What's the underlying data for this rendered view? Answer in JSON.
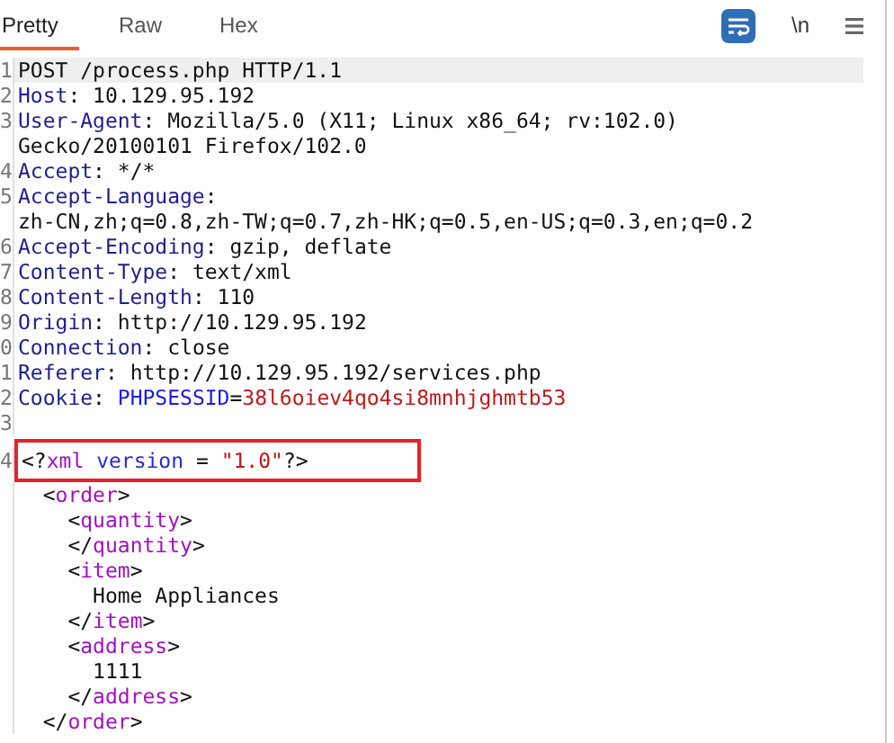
{
  "tabs": [
    {
      "label": "Pretty",
      "selected": true
    },
    {
      "label": "Raw",
      "selected": false
    },
    {
      "label": "Hex",
      "selected": false
    }
  ],
  "toolbar": {
    "wrap_toggle": {
      "on": true
    },
    "newline_toggle": {
      "label": "\\n",
      "on": false
    }
  },
  "lines": [
    {
      "number": "1",
      "highlighted": true,
      "segments": [
        {
          "kind": "value",
          "text": "POST /process.php HTTP/1.1"
        }
      ]
    },
    {
      "number": "2",
      "highlighted": false,
      "segments": [
        {
          "kind": "name",
          "text": "Host"
        },
        {
          "kind": "value",
          "text": ": 10.129.95.192"
        }
      ]
    },
    {
      "number": "3",
      "highlighted": false,
      "segments": [
        {
          "kind": "name",
          "text": "User-Agent"
        },
        {
          "kind": "value",
          "text": ": Mozilla/5.0 (X11; Linux x86_64; rv:102.0)"
        }
      ]
    },
    {
      "highlighted": false,
      "segments": [
        {
          "kind": "value",
          "text": "Gecko/20100101 Firefox/102.0"
        }
      ]
    },
    {
      "number": "4",
      "highlighted": false,
      "segments": [
        {
          "kind": "name",
          "text": "Accept"
        },
        {
          "kind": "value",
          "text": ": */*"
        }
      ]
    },
    {
      "number": "5",
      "highlighted": false,
      "segments": [
        {
          "kind": "name",
          "text": "Accept-Language"
        },
        {
          "kind": "value",
          "text": ":"
        }
      ]
    },
    {
      "highlighted": false,
      "segments": [
        {
          "kind": "value",
          "text": "zh-CN,zh;q=0.8,zh-TW;q=0.7,zh-HK;q=0.5,en-US;q=0.3,en;q=0.2"
        }
      ]
    },
    {
      "number": "6",
      "highlighted": false,
      "segments": [
        {
          "kind": "name",
          "text": "Accept-Encoding"
        },
        {
          "kind": "value",
          "text": ": gzip, deflate"
        }
      ]
    },
    {
      "number": "7",
      "highlighted": false,
      "segments": [
        {
          "kind": "name",
          "text": "Content-Type"
        },
        {
          "kind": "value",
          "text": ": text/xml"
        }
      ]
    },
    {
      "number": "8",
      "highlighted": false,
      "segments": [
        {
          "kind": "name",
          "text": "Content-Length"
        },
        {
          "kind": "value",
          "text": ": 110"
        }
      ]
    },
    {
      "number": "9",
      "highlighted": false,
      "segments": [
        {
          "kind": "name",
          "text": "Origin"
        },
        {
          "kind": "value",
          "text": ": http://10.129.95.192"
        }
      ]
    },
    {
      "number": "0",
      "highlighted": false,
      "segments": [
        {
          "kind": "name",
          "text": "Connection"
        },
        {
          "kind": "value",
          "text": ": close"
        }
      ]
    },
    {
      "number": "1",
      "highlighted": false,
      "segments": [
        {
          "kind": "name",
          "text": "Referer"
        },
        {
          "kind": "value",
          "text": ": http://10.129.95.192/services.php"
        }
      ]
    },
    {
      "number": "2",
      "highlighted": false,
      "segments": [
        {
          "kind": "name",
          "text": "Cookie"
        },
        {
          "kind": "value",
          "text": ": "
        },
        {
          "kind": "cookie-name",
          "text": "PHPSESSID"
        },
        {
          "kind": "value",
          "text": "="
        },
        {
          "kind": "cookie-value",
          "text": "38l6oiev4qo4si8mnhjghmtb53"
        }
      ]
    },
    {
      "number": "3",
      "highlighted": false
    },
    {
      "number": "4",
      "highlighted": false,
      "boxed": true,
      "segments": [
        {
          "kind": "punct",
          "text": "<?"
        },
        {
          "kind": "tag",
          "text": "xml"
        },
        {
          "kind": "attr",
          "text": " version"
        },
        {
          "kind": "punct",
          "text": " = "
        },
        {
          "kind": "string",
          "text": "\"1.0\""
        },
        {
          "kind": "punct",
          "text": "?>"
        }
      ],
      "children": [
        {
          "segments": [
            {
              "kind": "punct",
              "text": "<"
            },
            {
              "kind": "tag",
              "text": "order"
            },
            {
              "kind": "punct",
              "text": ">"
            }
          ],
          "children": [
            {
              "segments": [
                {
                  "kind": "punct",
                  "text": "<"
                },
                {
                  "kind": "tag",
                  "text": "quantity"
                },
                {
                  "kind": "punct",
                  "text": ">"
                }
              ]
            },
            {
              "segments": [
                {
                  "kind": "punct",
                  "text": "</"
                },
                {
                  "kind": "tag",
                  "text": "quantity"
                },
                {
                  "kind": "punct",
                  "text": ">"
                }
              ]
            },
            {
              "segments": [
                {
                  "kind": "punct",
                  "text": "<"
                },
                {
                  "kind": "tag",
                  "text": "item"
                },
                {
                  "kind": "punct",
                  "text": ">"
                }
              ],
              "children": [
                {
                  "segments": [
                    {
                      "kind": "value",
                      "text": "Home Appliances"
                    }
                  ]
                }
              ]
            },
            {
              "segments": [
                {
                  "kind": "punct",
                  "text": "</"
                },
                {
                  "kind": "tag",
                  "text": "item"
                },
                {
                  "kind": "punct",
                  "text": ">"
                }
              ]
            },
            {
              "segments": [
                {
                  "kind": "punct",
                  "text": "<"
                },
                {
                  "kind": "tag",
                  "text": "address"
                },
                {
                  "kind": "punct",
                  "text": ">"
                }
              ],
              "children": [
                {
                  "segments": [
                    {
                      "kind": "value",
                      "text": "1111"
                    }
                  ]
                }
              ]
            },
            {
              "segments": [
                {
                  "kind": "punct",
                  "text": "</"
                },
                {
                  "kind": "tag",
                  "text": "address"
                },
                {
                  "kind": "punct",
                  "text": ">"
                }
              ]
            }
          ]
        },
        {
          "segments": [
            {
              "kind": "punct",
              "text": "</"
            },
            {
              "kind": "tag",
              "text": "order"
            },
            {
              "kind": "punct",
              "text": ">"
            }
          ]
        }
      ]
    }
  ]
}
